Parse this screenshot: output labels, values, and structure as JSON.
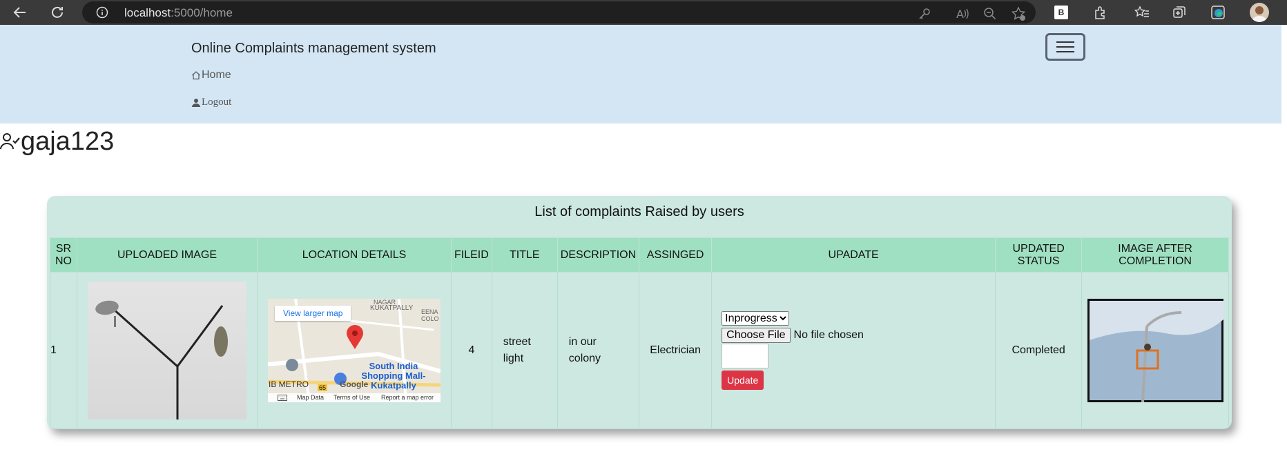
{
  "browser": {
    "url_host": "localhost",
    "url_path": ":5000/home"
  },
  "header": {
    "brand": "Online Complaints management system",
    "nav": [
      {
        "label": "Home",
        "icon": "house-icon"
      },
      {
        "label": "Logout",
        "icon": "person-icon"
      }
    ],
    "toggler_icon": "hamburger-menu-icon"
  },
  "user": {
    "name": "gaja123",
    "icon": "person-check-icon"
  },
  "complaints": {
    "title": "List of complaints Raised by users",
    "columns": [
      "SR NO",
      "UPLOADED IMAGE",
      "LOCATION DETAILS",
      "FILEID",
      "TITLE",
      "DESCRIPTION",
      "ASSINGED",
      "UPADATE",
      "UPDATED STATUS",
      "IMAGE AFTER COMPLETION"
    ],
    "rows": [
      {
        "sr_no": "1",
        "file_id": "4",
        "title": "street light",
        "description": "in our colony",
        "assigned": "Electrician",
        "status_select": "Inprogress",
        "choose_file": "Choose File",
        "no_file": "No file chosen",
        "update_button": "Update",
        "updated_status": "Completed",
        "map": {
          "view_larger": "View larger map",
          "place": "South India Shopping Mall-Kukatpally",
          "area_top": "KUKATPALLY",
          "area_top2": "NAGAR",
          "metro": "IB METRO",
          "road": "65",
          "footer_keys": "Map Data",
          "footer_terms": "Terms of Use",
          "footer_report": "Report a map error",
          "logo": "Google",
          "eena": "EENA",
          "colo": "COLO"
        }
      }
    ]
  },
  "colors": {
    "header_bg": "#d4e6f4",
    "card_bg": "#cce8e0",
    "table_head_bg": "#9fe0c2",
    "update_button": "#dc3545"
  }
}
